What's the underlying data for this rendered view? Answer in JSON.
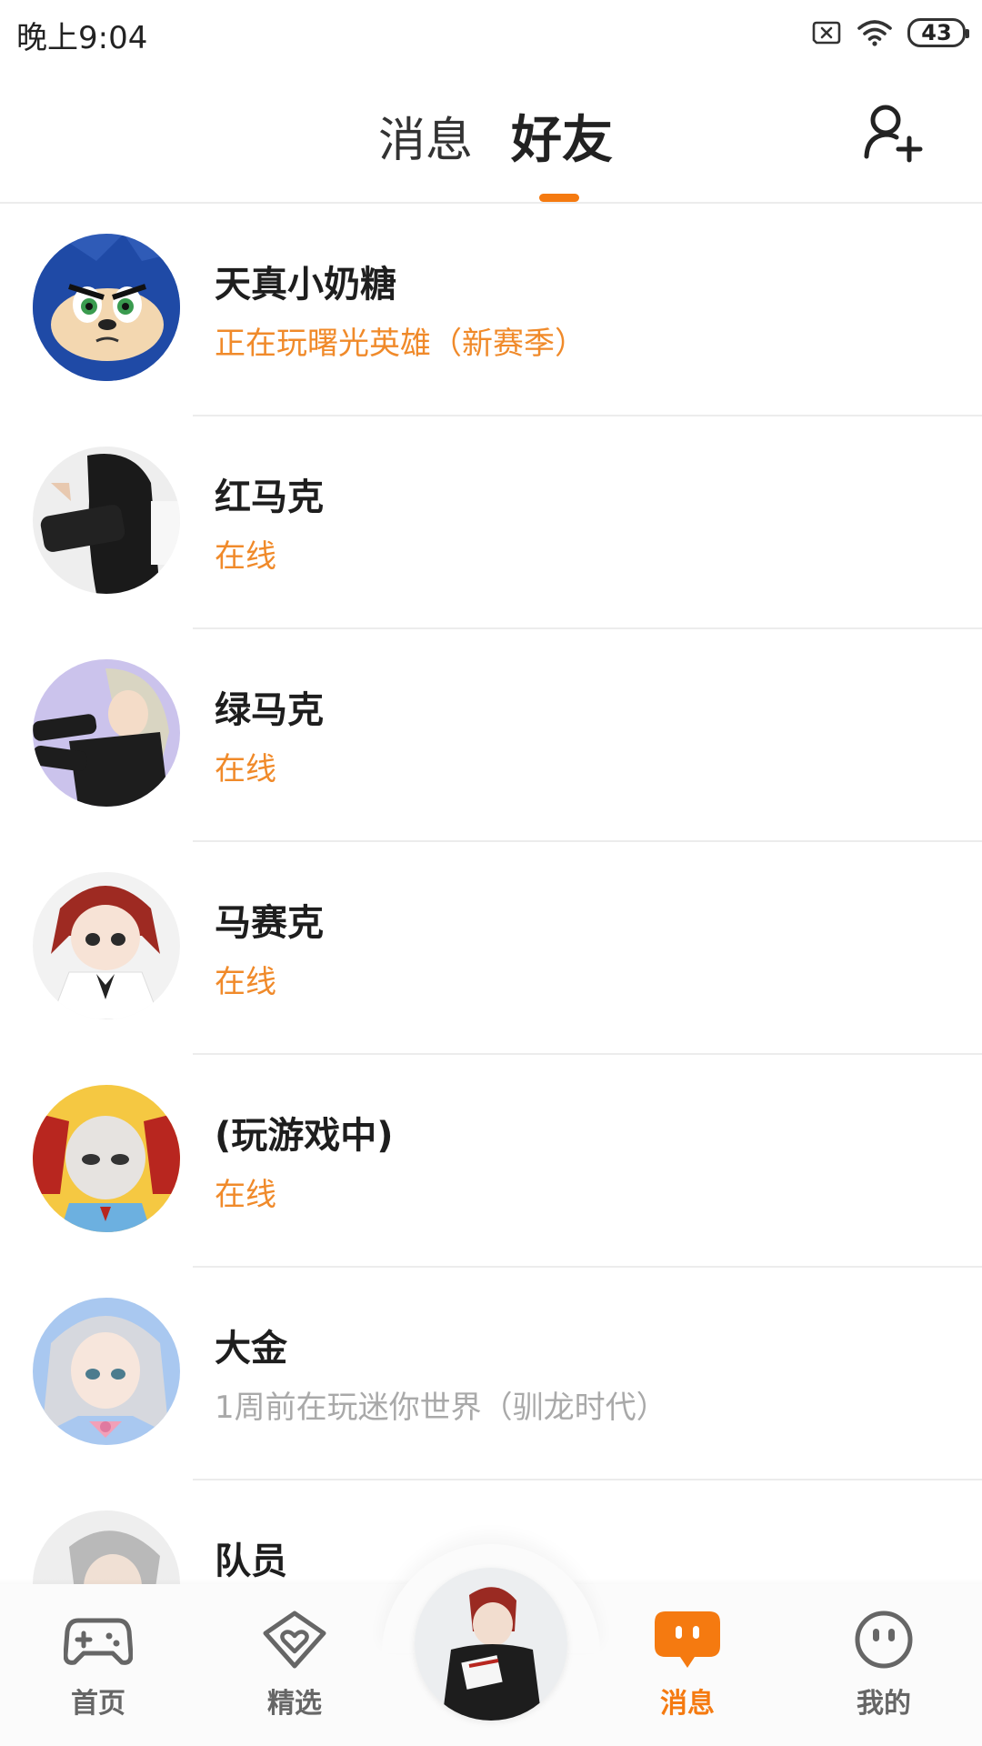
{
  "status_bar": {
    "time": "晚上9:04",
    "battery": "43",
    "icons": [
      "sim-off-icon",
      "wifi-icon",
      "battery-icon"
    ]
  },
  "header": {
    "tabs": [
      {
        "label": "消息",
        "active": false
      },
      {
        "label": "好友",
        "active": true
      }
    ],
    "add_friend_icon": "add-user-icon"
  },
  "friends": [
    {
      "name": "天真小奶糖",
      "status": "正在玩曙光英雄（新赛季）",
      "status_type": "playing"
    },
    {
      "name": "红马克",
      "status": "在线",
      "status_type": "online"
    },
    {
      "name": "绿马克",
      "status": "在线",
      "status_type": "online"
    },
    {
      "name": "马赛克",
      "status": "在线",
      "status_type": "online"
    },
    {
      "name": "(玩游戏中)",
      "status": "在线",
      "status_type": "online"
    },
    {
      "name": "大金",
      "status": "1周前在玩迷你世界（驯龙时代）",
      "status_type": "offline"
    },
    {
      "name": "队员",
      "status": "",
      "status_type": "unknown"
    }
  ],
  "bottom_nav": {
    "items": [
      {
        "label": "首页",
        "icon": "gamepad-icon",
        "active": false
      },
      {
        "label": "精选",
        "icon": "heart-badge-icon",
        "active": false
      },
      {
        "label": "消息",
        "icon": "chat-bubble-icon",
        "active": true
      },
      {
        "label": "我的",
        "icon": "face-icon",
        "active": false
      }
    ],
    "center_icon": "profile-avatar"
  },
  "colors": {
    "accent": "#f57a10",
    "status_online": "#f08a2a",
    "status_offline": "#a9a9a9"
  }
}
